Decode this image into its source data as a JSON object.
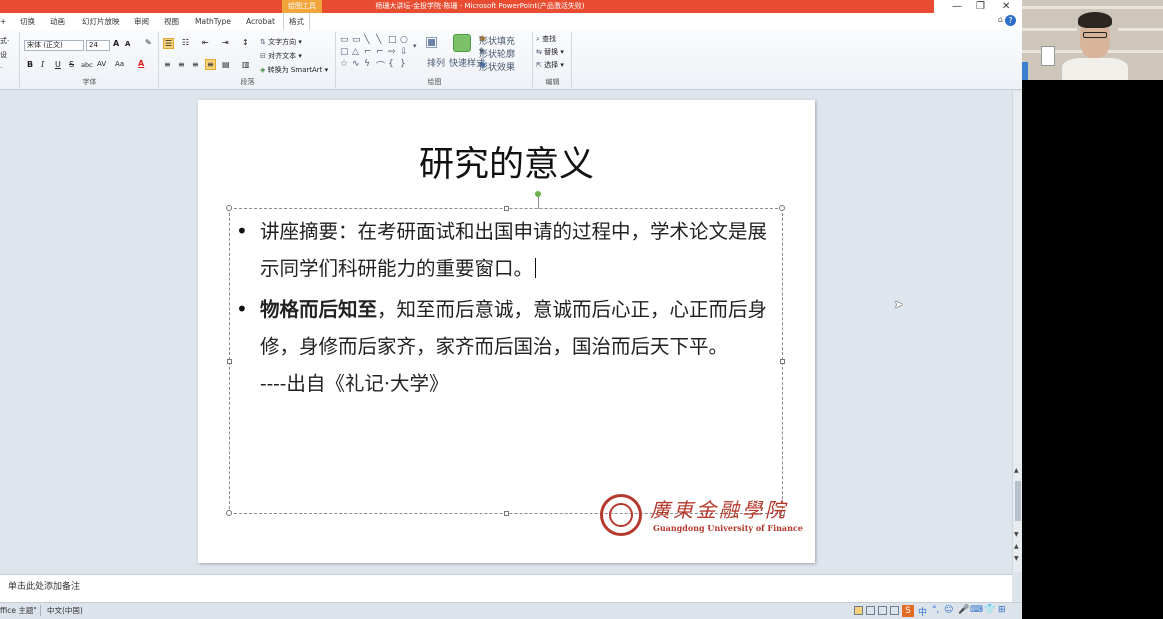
{
  "titlebar": {
    "context_tab": "绘图工具",
    "window_title": "杨珊大讲坛-金投学院-陈珊 - Microsoft PowerPoint(产品激活失败)",
    "minimize": "—",
    "restore": "❐",
    "close": "✕"
  },
  "tabs": {
    "items": [
      "切换",
      "动画",
      "幻灯片放映",
      "审阅",
      "视图",
      "MathType",
      "Acrobat",
      "格式"
    ],
    "partial_left": "+",
    "active": "格式"
  },
  "ribbon": {
    "left_partial": [
      "式·",
      "设",
      "·"
    ],
    "font": {
      "name": "宋体 (正文)",
      "size": "24",
      "grow": "A",
      "shrink": "A",
      "bold": "B",
      "italic": "I",
      "underline": "U",
      "strike": "S",
      "shadow": "abc",
      "spacing": "AV",
      "case": "Aa",
      "color": "A",
      "label": "字体"
    },
    "paragraph": {
      "text_direction": "文字方向",
      "align_text": "对齐文本",
      "smartart": "转换为 SmartArt",
      "label": "段落"
    },
    "drawing": {
      "arrange": "排列",
      "quick_styles": "快速样式",
      "shape_fill": "形状填充",
      "shape_outline": "形状轮廓",
      "shape_effects": "形状效果",
      "label": "绘图"
    },
    "editing": {
      "find": "查找",
      "replace": "替换",
      "select": "选择",
      "label": "编辑"
    }
  },
  "slide": {
    "title": "研究的意义",
    "bullet_char": "•",
    "para1": "讲座摘要：在考研面试和出国申请的过程中，学术论文是展示同学们科研能力的重要窗口。",
    "para2_bold": "物格而后知至",
    "para2_rest": "，知至而后意诚，意诚而后心正，心正而后身修，身修而后家齐，家齐而后国治，国治而后天下平。",
    "para2_source": "----出自《礼记·大学》",
    "logo_cn": "廣東金融學院",
    "logo_en": "Guangdong University of Finance"
  },
  "notes": {
    "placeholder": "单击此处添加备注"
  },
  "status": {
    "theme": "ffice 主题\"",
    "language": "中文(中国)",
    "ime": "S",
    "tray": [
      "中",
      "°,",
      "☺",
      "🎤",
      "⌨",
      "👕",
      "⊞"
    ]
  }
}
